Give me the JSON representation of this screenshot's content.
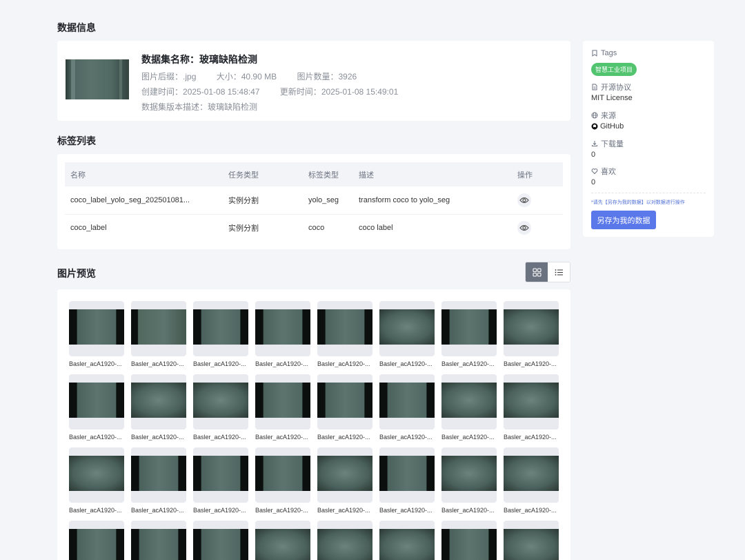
{
  "sections": {
    "data_info": "数据信息",
    "label_list": "标签列表",
    "image_preview": "图片预览"
  },
  "dataset": {
    "name_label": "数据集名称：",
    "name": "玻璃缺陷检测",
    "suffix_label": "图片后缀：",
    "suffix": ".jpg",
    "size_label": "大小：",
    "size": "40.90 MB",
    "count_label": "图片数量：",
    "count": "3926",
    "created_label": "创建时间：",
    "created": "2025-01-08 15:48:47",
    "updated_label": "更新时间：",
    "updated": "2025-01-08 15:49:01",
    "desc_label": "数据集版本描述：",
    "desc": "玻璃缺陷检测"
  },
  "label_table": {
    "headers": [
      "名称",
      "任务类型",
      "标签类型",
      "描述",
      "操作"
    ],
    "rows": [
      {
        "name": "coco_label_yolo_seg_202501081...",
        "task": "实例分割",
        "type": "yolo_seg",
        "desc": "transform coco to yolo_seg"
      },
      {
        "name": "coco_label",
        "task": "实例分割",
        "type": "coco",
        "desc": "coco label"
      }
    ]
  },
  "side": {
    "tags_label": "Tags",
    "tag": "智慧工业项目",
    "license_label": "开源协议",
    "license": "MIT License",
    "source_label": "来源",
    "source": "GitHub",
    "downloads_label": "下载量",
    "downloads": "0",
    "likes_label": "喜欢",
    "likes": "0",
    "hint": "*请先【另存为我的数据】以对数据进行操作",
    "save_button": "另存为我的数据"
  },
  "gallery": {
    "caption": "Basler_acA1920-..."
  },
  "colors": {
    "accent": "#5a78ea",
    "tag_green": "#52c470",
    "page_bg": "#f4f5f8"
  }
}
